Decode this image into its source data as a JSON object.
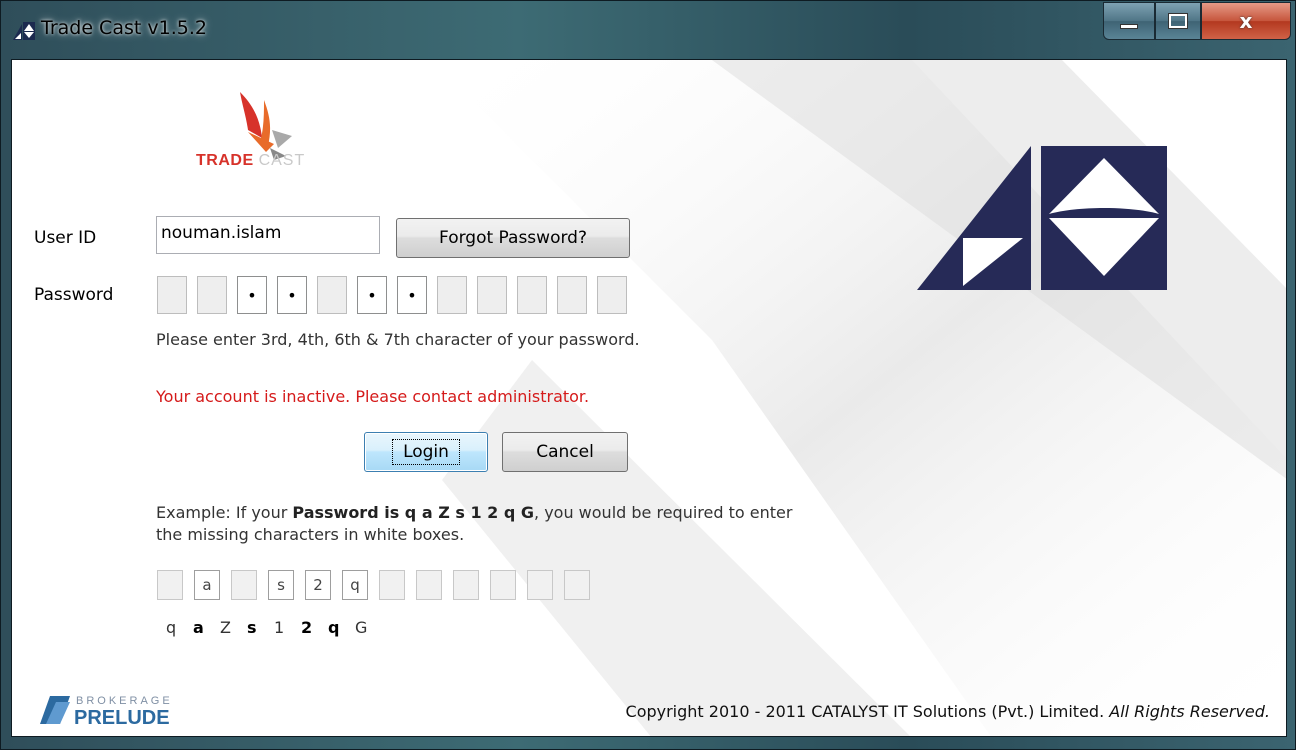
{
  "window": {
    "title": "Trade Cast v1.5.2",
    "close_glyph": "x"
  },
  "logo": {
    "trade": "TRADE",
    "cast": "CAST"
  },
  "form": {
    "userid_label": "User ID",
    "userid_value": "nouman.islam",
    "forgot_label": "Forgot Password?",
    "password_label": "Password",
    "password_boxes": [
      "",
      "",
      "•",
      "•",
      "",
      "•",
      "•",
      "",
      "",
      "",
      "",
      ""
    ],
    "hint": "Please enter 3rd, 4th, 6th & 7th character of your password.",
    "error": "Your account is inactive. Please contact administrator.",
    "login_label": "Login",
    "cancel_label": "Cancel"
  },
  "example": {
    "line1_prefix": "Example: If your ",
    "line1_bold": "Password is q a Z s 1 2 q G",
    "line1_suffix": ", you would be required to enter",
    "line2": "the missing characters in white boxes.",
    "boxes": [
      "",
      "a",
      "",
      "s",
      "2",
      "q",
      "",
      "",
      "",
      "",
      "",
      ""
    ],
    "chars": [
      {
        "c": "q",
        "bold": false
      },
      {
        "c": "a",
        "bold": true
      },
      {
        "c": "Z",
        "bold": false
      },
      {
        "c": "s",
        "bold": true
      },
      {
        "c": "1",
        "bold": false
      },
      {
        "c": "2",
        "bold": true
      },
      {
        "c": "q",
        "bold": true
      },
      {
        "c": "G",
        "bold": false
      }
    ]
  },
  "footer": {
    "brand_top": "BROKERAGE",
    "brand_bottom": "PRELUDE",
    "copyright_main": "Copyright 2010 - 2011 CATALYST IT Solutions (Pvt.) Limited. ",
    "copyright_italic": "All Rights Reserved."
  },
  "colors": {
    "error": "#d51a1a",
    "navy": "#262a57",
    "accent_red": "#d7322a"
  }
}
